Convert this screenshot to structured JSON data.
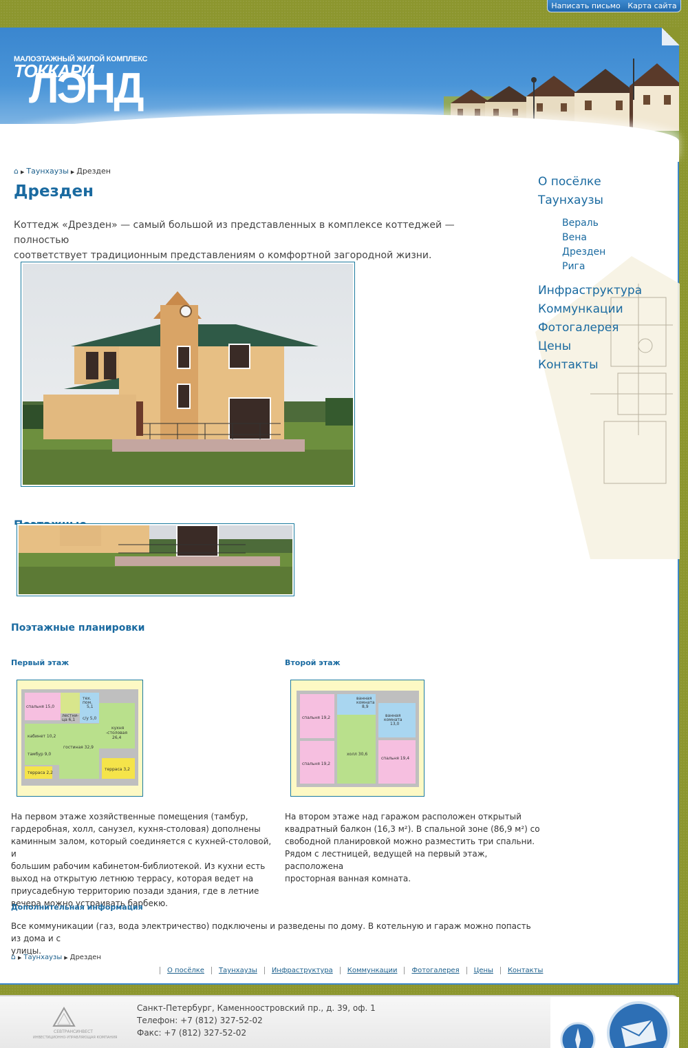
{
  "top_links": {
    "write": "Написать письмо",
    "sitemap": "Карта сайта"
  },
  "logo": {
    "tagline": "МАЛОЭТАЖНЫЙ ЖИЛОЙ КОМПЛЕКС",
    "line1": "ТОККАРИ",
    "line2": "ЛЭНД"
  },
  "breadcrumb": {
    "home_icon": "home-icon",
    "parent": "Таунхаузы",
    "current": "Дрезден"
  },
  "page": {
    "title": "Дрезден",
    "intro_1": "Коттедж «Дрезден» — самый большой из представленных в комплексе коттеджей — полностью",
    "intro_2": "соответствует традиционным представлениям о комфортной загородной жизни."
  },
  "right_nav": {
    "items_top": [
      "О посёлке",
      "Таунхаузы"
    ],
    "sub_items": [
      "Вераль",
      "Вена",
      "Дрезден",
      "Рига"
    ],
    "items_bottom": [
      "Инфраструктура",
      "Коммункации",
      "Фотогалерея",
      "Цены",
      "Контакты"
    ]
  },
  "ghost_heading": "Поэтажные планировки",
  "plans": {
    "heading": "Поэтажные планировки",
    "floor1": {
      "label": "Первый этаж",
      "text": [
        "На первом этаже хозяйственные помещения (тамбур,",
        "гардеробная, холл, санузел, кухня-столовая) дополнены",
        "каминным залом, который соединяется с кухней-столовой, и",
        "большим рабочим кабинетом-библиотекой. Из кухни есть",
        "выход на открытую летнюю террасу, которая ведет на",
        "приусадебную территорию позади здания, где в летние",
        "вечера можно устраивать барбекю."
      ],
      "rooms": [
        "спальня 15,0",
        "тех. пом. 5,1",
        "лестни- ца 6,1",
        "с/у 5,0",
        "кухня -столовая 26,4",
        "кабинет 10,2",
        "гостиная 32,9",
        "тамбур 9,0",
        "терраса 2,2",
        "терраса 3,2"
      ]
    },
    "floor2": {
      "label": "Второй этаж",
      "text": [
        "На втором этаже над гаражом расположен открытый",
        "квадратный балкон (16,3 м²). В спальной зоне (86,9 м²) со",
        "свободной планировкой можно разместить три спальни.",
        "Рядом с лестницей, ведущей на первый этаж, расположена",
        "просторная ванная комната."
      ],
      "rooms": [
        "спальня 19,2",
        "ванная комната 8,9",
        "ванная комната 13,0",
        "холл 30,6",
        "спальня 19,2",
        "спальня 19,4"
      ]
    }
  },
  "extra": {
    "heading": "Дополнительная информация",
    "text_1": "Все коммуникации (газ, вода электричество) подключены и разведены по дому. В котельную и гараж можно попасть из дома и с",
    "text_2": "улицы."
  },
  "bottom_nav": [
    "О посёлке",
    "Таунхаузы",
    "Инфраструктура",
    "Коммункации",
    "Фотогалерея",
    "Цены",
    "Контакты"
  ],
  "footer": {
    "address": "Санкт-Петербург, Каменноостровский пр., д. 39, оф. 1",
    "phone": "Телефон: +7 (812) 327-52-02",
    "fax": "Факс: +7 (812) 327-52-02",
    "logo_name": "СЕВТРАНСИНВЕСТ",
    "logo_sub": "ИНВЕСТИЦИОННО-УПРАВЛЯЮЩАЯ КОМПАНИЯ"
  },
  "colors": {
    "accent": "#1a6aa0",
    "header_blue": "#3a86cf",
    "background": "#8c962e"
  }
}
